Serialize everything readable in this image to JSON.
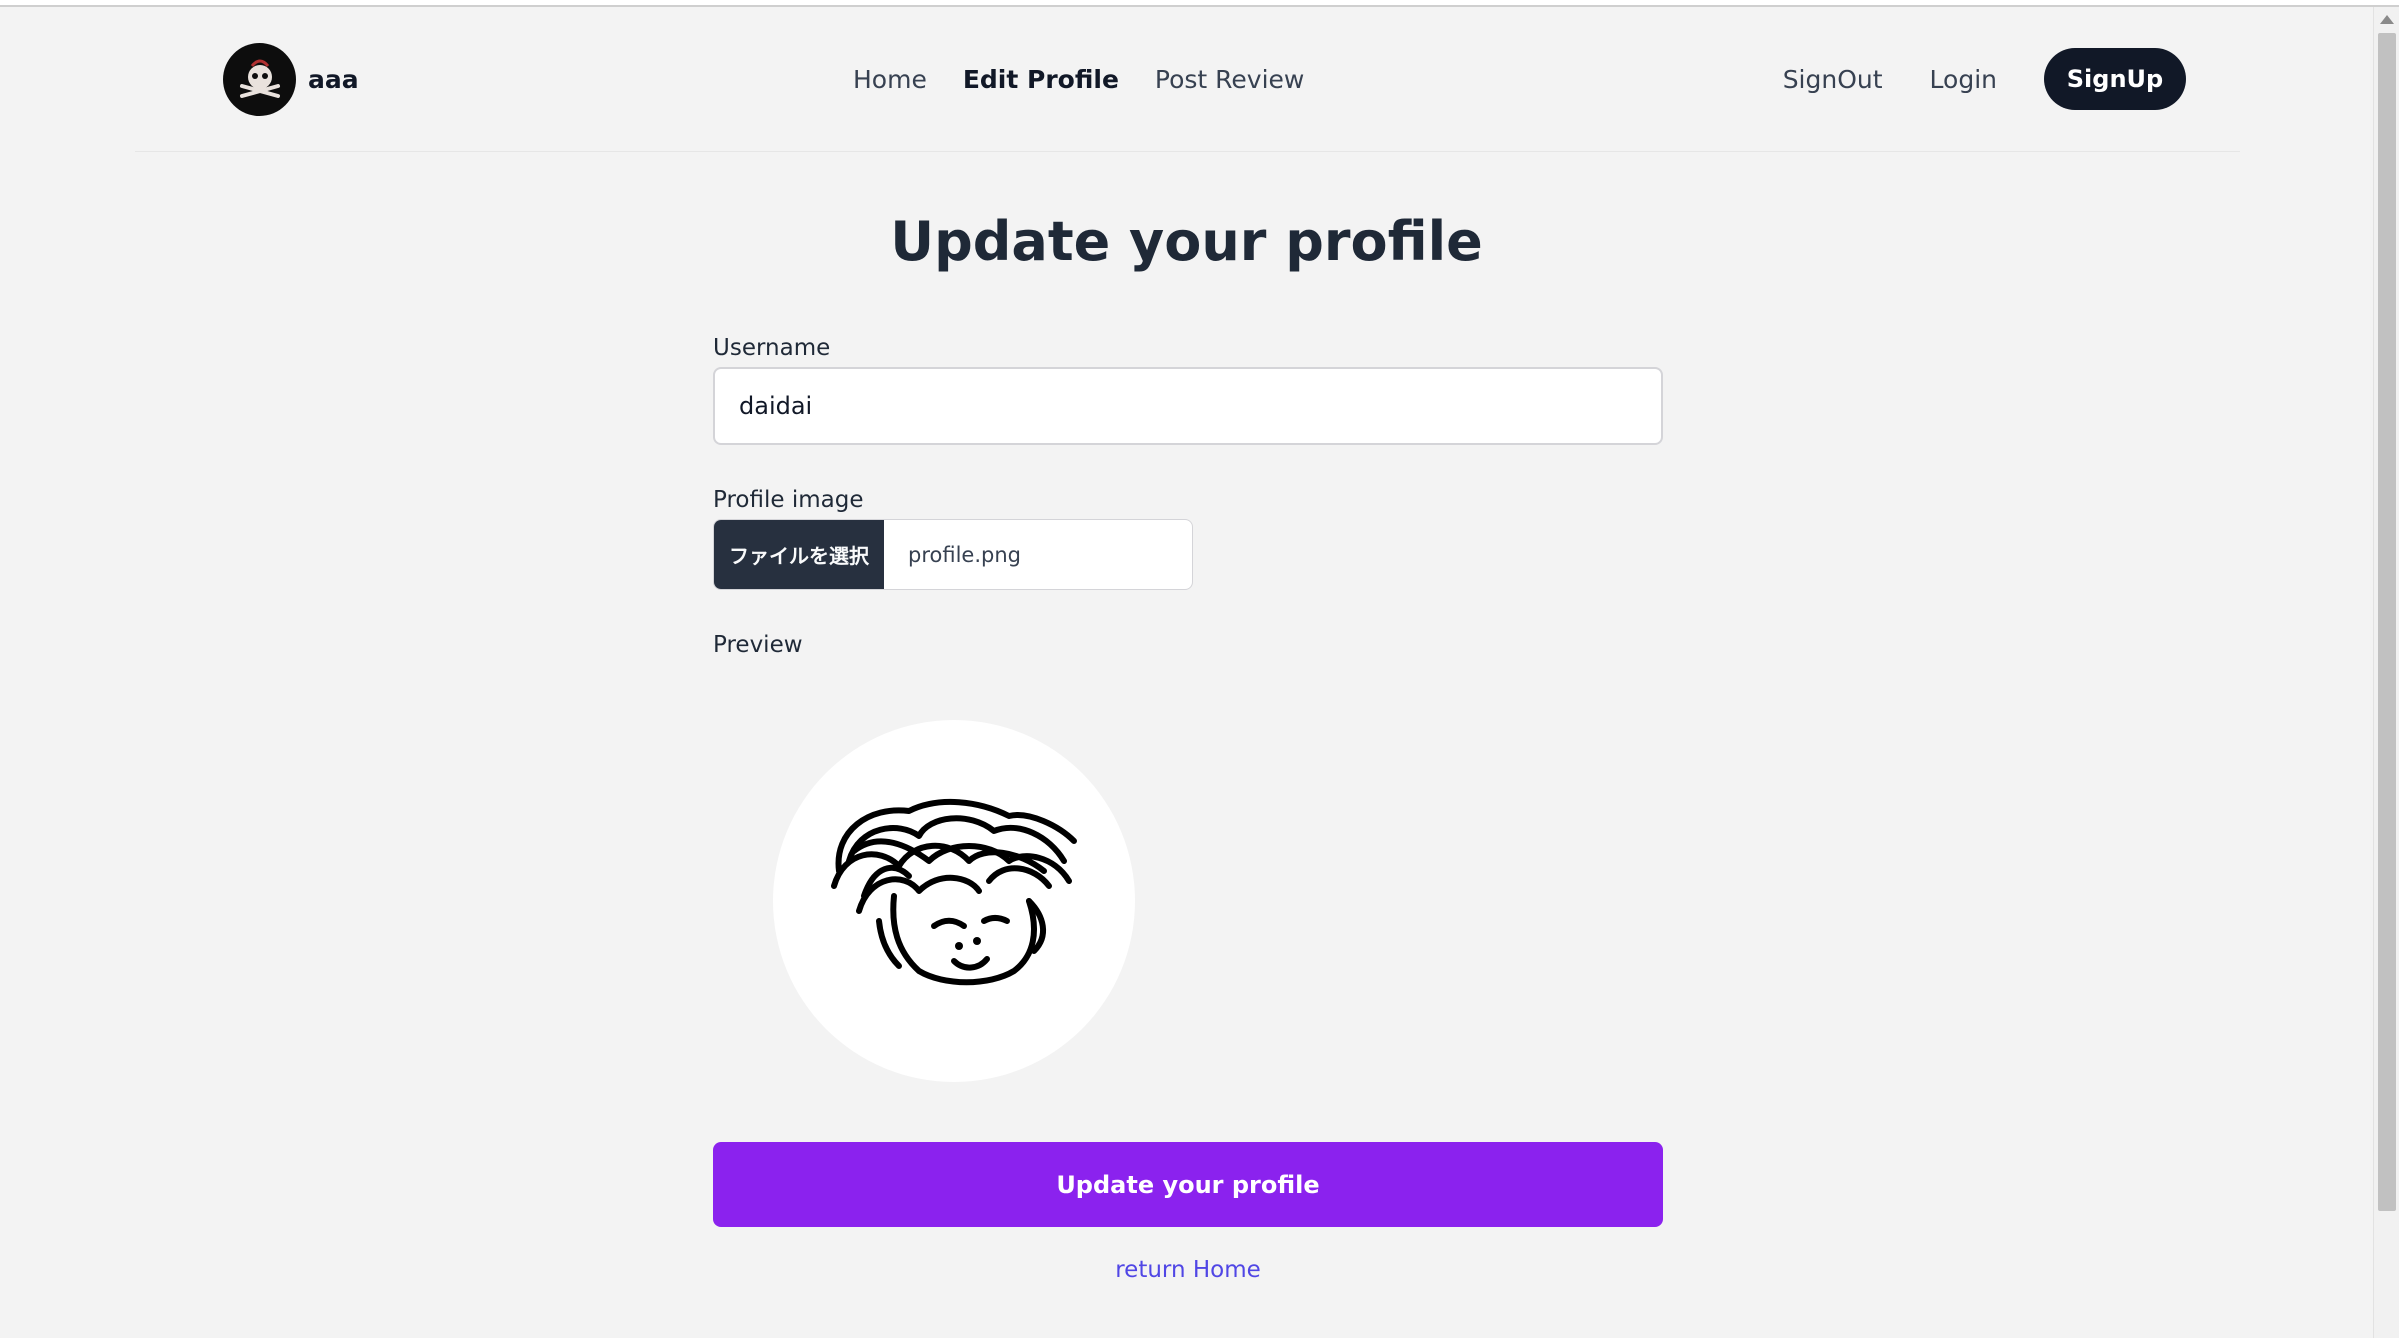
{
  "header": {
    "brand_name": "aaa",
    "nav": [
      {
        "label": "Home"
      },
      {
        "label": "Edit Profile"
      },
      {
        "label": "Post Review"
      }
    ],
    "auth": {
      "signout": "SignOut",
      "login": "Login",
      "signup": "SignUp"
    }
  },
  "main": {
    "title": "Update your profile",
    "username": {
      "label": "Username",
      "value": "daidai"
    },
    "profile_image": {
      "label": "Profile image",
      "button": "ファイルを選択",
      "file_name": "profile.png"
    },
    "preview": {
      "label": "Preview"
    },
    "submit": "Update your profile",
    "return_link": "return Home"
  },
  "colors": {
    "background": "#f3f3f3",
    "primary": "#8b22ee",
    "dark": "#111827",
    "link": "#5046e5"
  },
  "icons": {
    "brand_avatar": "skull-logo-icon",
    "preview_image": "face-drawing-icon"
  }
}
